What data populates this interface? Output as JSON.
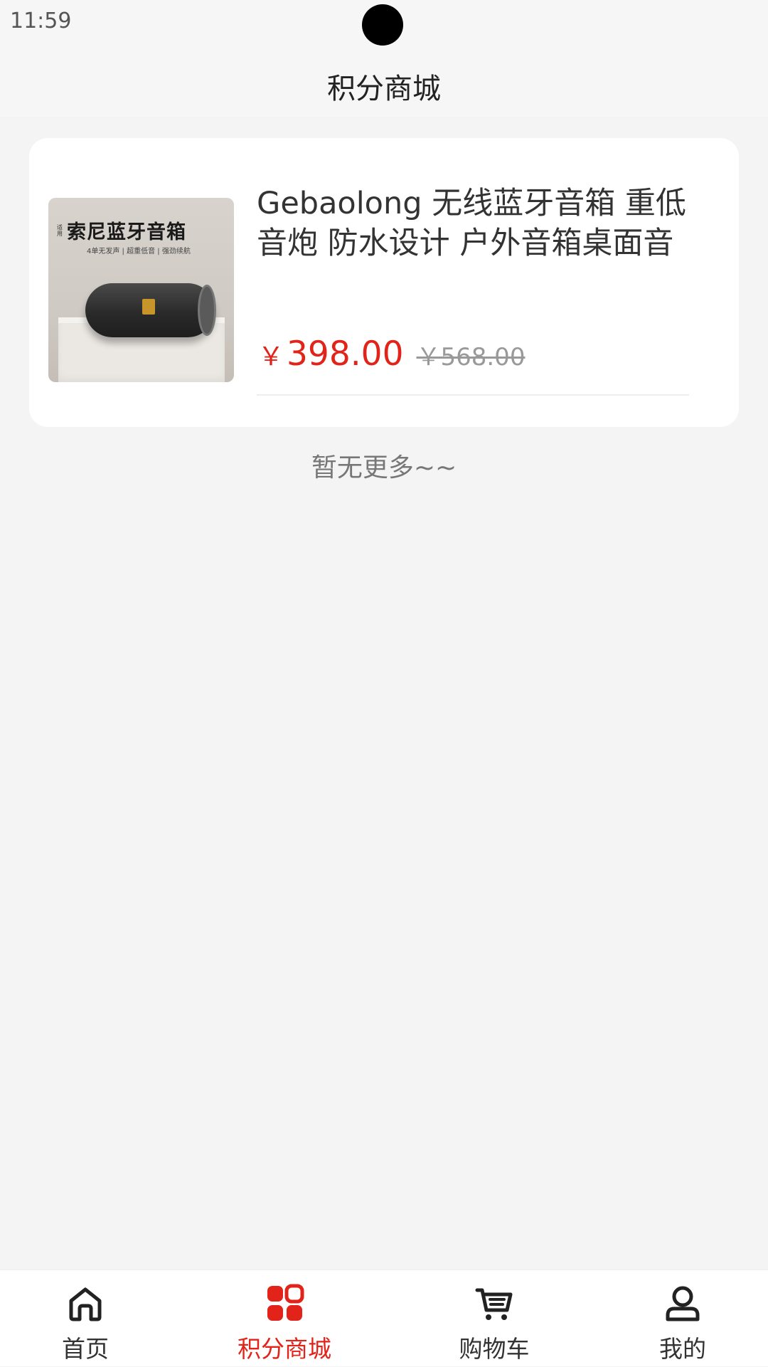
{
  "status_bar": {
    "time": "11:59"
  },
  "header": {
    "title": "积分商城"
  },
  "products": [
    {
      "image_title": "索尼蓝牙音箱",
      "image_tag": "适用",
      "image_subtitle": "4单无发声 | 超重低音 | 强劲续航",
      "title": "Gebaolong 无线蓝牙音箱 重低音炮 防水设计 户外音箱桌面音",
      "price_symbol": "￥",
      "price": "398.00",
      "old_price": "￥568.00"
    }
  ],
  "list_end_text": "暂无更多~~",
  "tab_bar": {
    "active_color": "#e2231a",
    "items": [
      {
        "label": "首页",
        "icon": "home-icon"
      },
      {
        "label": "积分商城",
        "icon": "grid-icon",
        "active": true
      },
      {
        "label": "购物车",
        "icon": "cart-icon"
      },
      {
        "label": "我的",
        "icon": "user-icon"
      }
    ]
  }
}
